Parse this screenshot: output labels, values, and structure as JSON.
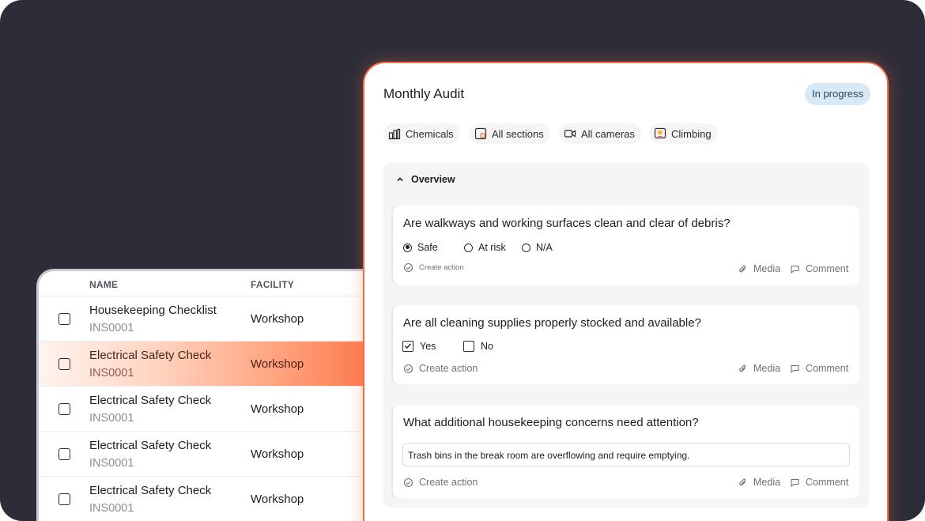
{
  "table": {
    "headers": {
      "name": "NAME",
      "facility": "FACILITY"
    },
    "rows": [
      {
        "name": "Housekeeping Checklist",
        "code": "INS0001",
        "facility": "Workshop"
      },
      {
        "name": "Electrical Safety Check",
        "code": "INS0001",
        "facility": "Workshop"
      },
      {
        "name": "Electrical Safety Check",
        "code": "INS0001",
        "facility": "Workshop"
      },
      {
        "name": "Electrical Safety Check",
        "code": "INS0001",
        "facility": "Workshop"
      },
      {
        "name": "Electrical Safety Check",
        "code": "INS0001",
        "facility": "Workshop"
      }
    ],
    "highlighted_row": 1
  },
  "audit": {
    "title": "Monthly Audit",
    "status": "In progress",
    "filters": [
      {
        "label": "Chemicals",
        "icon": "chemicals-icon"
      },
      {
        "label": "All sections",
        "icon": "sections-icon"
      },
      {
        "label": "All cameras",
        "icon": "camera-icon"
      },
      {
        "label": "Climbing",
        "icon": "climbing-icon"
      }
    ],
    "section": {
      "title": "Overview",
      "icon": "chevron-up-icon"
    },
    "questions": [
      {
        "text": "Are walkways and working surfaces clean and clear of debris?",
        "options": [
          {
            "label": "Safe",
            "selected": true
          },
          {
            "label": "At risk",
            "selected": false
          },
          {
            "label": "N/A",
            "selected": false
          }
        ],
        "create_action": "Create action",
        "media": "Media",
        "comment": "Comment"
      },
      {
        "text": "Are all cleaning supplies properly stocked and available?",
        "options": [
          {
            "label": "Yes",
            "checked": true
          },
          {
            "label": "No",
            "checked": false
          }
        ],
        "create_action": "Create action",
        "media": "Media",
        "comment": "Comment"
      },
      {
        "text": "What additional housekeeping concerns need attention?",
        "response": "Trash bins in the break room are overflowing and require emptying.",
        "create_action": "Create action",
        "media": "Media",
        "comment": "Comment"
      }
    ]
  },
  "colors": {
    "background": "#2d2d39",
    "accent": "#f26c48",
    "badge": "#d7e9f6",
    "panel_bg": "#f6f5f3"
  }
}
